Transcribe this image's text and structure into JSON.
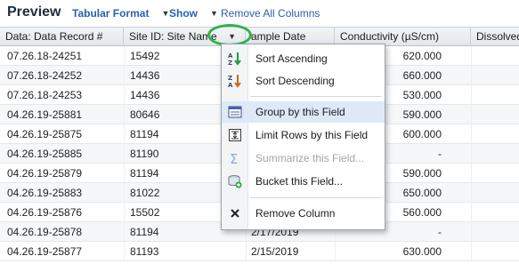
{
  "toolbar": {
    "title": "Preview",
    "tabular_format": "Tabular Format",
    "show": "Show",
    "remove_all_columns": "Remove All Columns",
    "caret": "▼"
  },
  "table": {
    "headers": [
      "Data: Data Record #",
      "Site ID: Site Name",
      "ample Date",
      "Conductivity (µS/cm)",
      "Dissolved"
    ],
    "rows": [
      [
        "07.26.18-24251",
        "15492",
        "",
        "620.000"
      ],
      [
        "07.26.18-24252",
        "14436",
        "",
        "660.000"
      ],
      [
        "07.26.18-24253",
        "14436",
        "",
        "530.000"
      ],
      [
        "04.26.19-25881",
        "80646",
        "",
        "590.000"
      ],
      [
        "04.26.19-25875",
        "81194",
        "",
        "600.000"
      ],
      [
        "04.26.19-25885",
        "81190",
        "",
        "-"
      ],
      [
        "04.26.19-25879",
        "81194",
        "",
        "590.000"
      ],
      [
        "04.26.19-25883",
        "81022",
        "",
        "650.000"
      ],
      [
        "04.26.19-25876",
        "15502",
        "",
        "560.000"
      ],
      [
        "04.26.19-25878",
        "81194",
        "2/17/2019",
        "-"
      ],
      [
        "04.26.19-25877",
        "81193",
        "2/15/2019",
        "630.000"
      ]
    ]
  },
  "context_menu": {
    "items": [
      {
        "label": "Sort Ascending",
        "icon": "sort-ascending-icon"
      },
      {
        "label": "Sort Descending",
        "icon": "sort-descending-icon"
      },
      {
        "label": "Group by this Field",
        "icon": "group-icon"
      },
      {
        "label": "Limit Rows by this Field",
        "icon": "limit-rows-icon"
      },
      {
        "label": "Summarize this Field...",
        "icon": "sigma-icon"
      },
      {
        "label": "Bucket this Field...",
        "icon": "bucket-icon"
      },
      {
        "label": "Remove Column",
        "icon": "close-icon"
      }
    ]
  },
  "colors": {
    "link": "#2a62a8",
    "highlight": "#dde9f6",
    "annotation": "#2fb34a"
  }
}
